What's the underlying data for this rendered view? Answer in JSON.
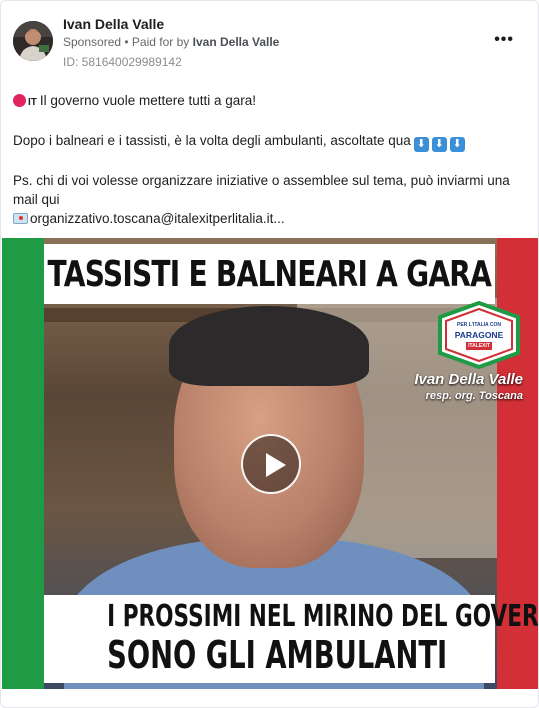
{
  "post": {
    "author": "Ivan Della Valle",
    "sponsored": "Sponsored",
    "paid_for_prefix": "• Paid for by",
    "paid_for_by": "Ivan Della Valle",
    "library_id": "ID: 581640029989142",
    "more_label": "•••"
  },
  "body": {
    "line1_flag": "IT",
    "line1": "Il governo vuole mettere tutti a gara!",
    "line2": "Dopo i balneari e i tassisti, è la volta degli ambulanti, ascoltate qua",
    "arrow_glyph": "⬇",
    "line3": "Ps. chi di voi volesse organizzare iniziative o assemblee sul tema, può inviarmi una mail qui",
    "line4": "organizzativo.toscana@italexitperlitalia.it..."
  },
  "video": {
    "top_title": "TASSISTI E BALNEARI A GARA",
    "bottom_line1": "I PROSSIMI NEL MIRINO DEL GOVERNO",
    "bottom_line2": "SONO GLI AMBULANTI",
    "logo_top": "PER L'ITALIA CON",
    "logo_main": "PARAGONE",
    "logo_bottom": "ITALEXIT",
    "name_caption": "Ivan Della Valle",
    "role_caption": "resp. org. Toscana"
  },
  "colors": {
    "flag_green": "#1f9b46",
    "flag_red": "#d22f36",
    "text_primary": "#1c1e21",
    "text_secondary": "#65676b"
  }
}
